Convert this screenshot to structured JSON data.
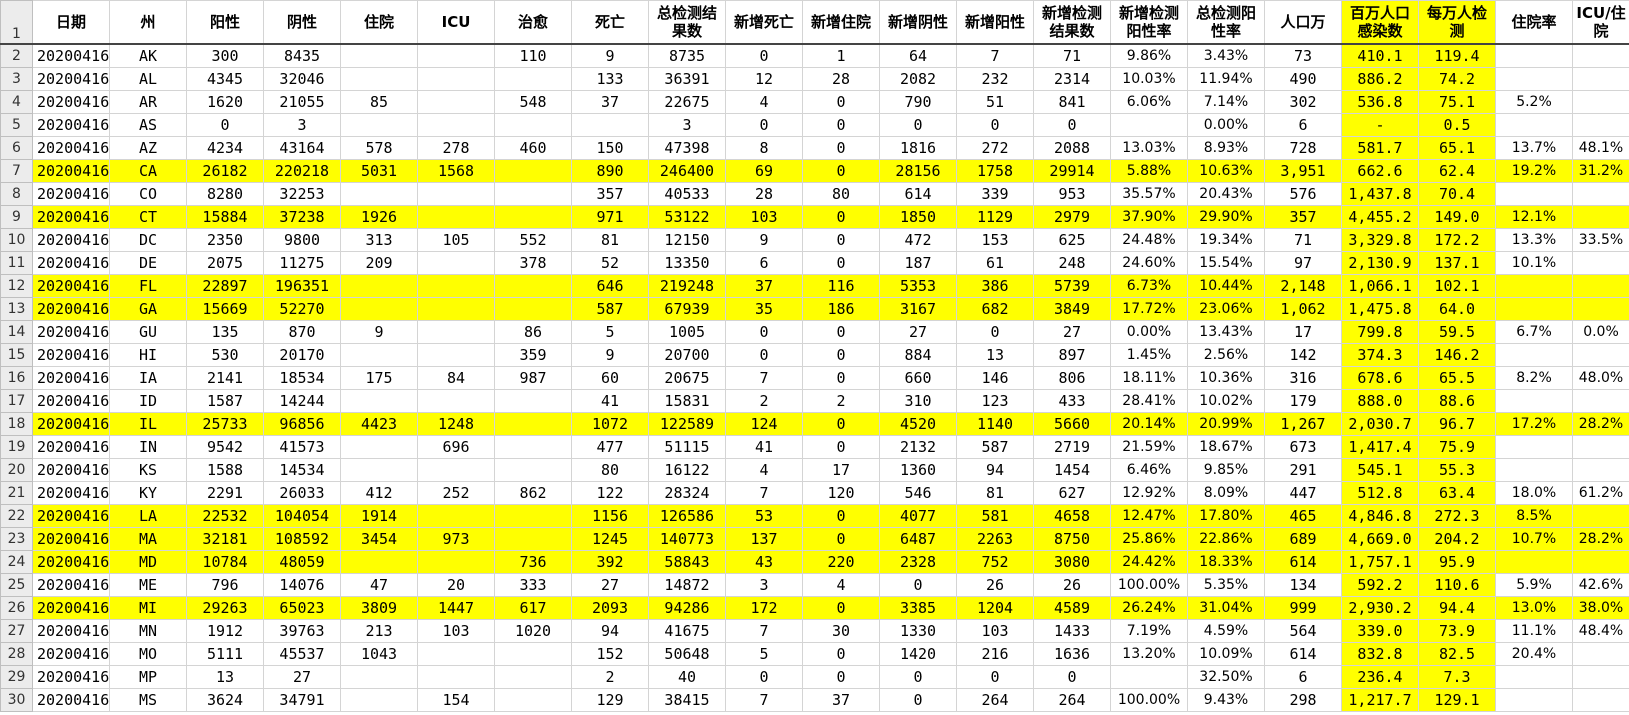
{
  "sheet": {
    "headers": [
      {
        "key": "date",
        "label": "日期"
      },
      {
        "key": "state",
        "label": "州"
      },
      {
        "key": "positive",
        "label": "阳性"
      },
      {
        "key": "negative",
        "label": "阴性"
      },
      {
        "key": "hospitalized",
        "label": "住院"
      },
      {
        "key": "icu",
        "label": "ICU"
      },
      {
        "key": "recovered",
        "label": "治愈"
      },
      {
        "key": "deaths",
        "label": "死亡"
      },
      {
        "key": "total_tests",
        "label": "总检测结果数"
      },
      {
        "key": "new_deaths",
        "label": "新增死亡"
      },
      {
        "key": "new_hosp",
        "label": "新增住院"
      },
      {
        "key": "new_neg",
        "label": "新增阴性"
      },
      {
        "key": "new_pos",
        "label": "新增阳性"
      },
      {
        "key": "new_tests",
        "label": "新增检测结果数"
      },
      {
        "key": "new_pos_rate",
        "label": "新增检测阳性率"
      },
      {
        "key": "total_pos_rate",
        "label": "总检测阳性率"
      },
      {
        "key": "population",
        "label": "人口万"
      },
      {
        "key": "per_million",
        "label": "百万人口感染数"
      },
      {
        "key": "per_10k_tests",
        "label": "每万人检测"
      },
      {
        "key": "hosp_rate",
        "label": "住院率"
      },
      {
        "key": "icu_hosp",
        "label": "ICU/住院"
      }
    ],
    "row_numbers": [
      "1",
      "2",
      "3",
      "4",
      "5",
      "6",
      "7",
      "8",
      "9",
      "10",
      "11",
      "12",
      "13",
      "14",
      "15",
      "16",
      "17",
      "18",
      "19",
      "20",
      "21",
      "22",
      "23",
      "24",
      "25",
      "26",
      "27",
      "28",
      "29",
      "30"
    ],
    "rows": [
      {
        "highlight": false,
        "cells": [
          "20200416",
          "AK",
          "300",
          "8435",
          "",
          "",
          "110",
          "9",
          "8735",
          "0",
          "1",
          "64",
          "7",
          "71",
          "9.86%",
          "3.43%",
          "73",
          "410.1",
          "119.4",
          "",
          ""
        ]
      },
      {
        "highlight": false,
        "cells": [
          "20200416",
          "AL",
          "4345",
          "32046",
          "",
          "",
          "",
          "133",
          "36391",
          "12",
          "28",
          "2082",
          "232",
          "2314",
          "10.03%",
          "11.94%",
          "490",
          "886.2",
          "74.2",
          "",
          ""
        ]
      },
      {
        "highlight": false,
        "cells": [
          "20200416",
          "AR",
          "1620",
          "21055",
          "85",
          "",
          "548",
          "37",
          "22675",
          "4",
          "0",
          "790",
          "51",
          "841",
          "6.06%",
          "7.14%",
          "302",
          "536.8",
          "75.1",
          "5.2%",
          ""
        ]
      },
      {
        "highlight": false,
        "cells": [
          "20200416",
          "AS",
          "0",
          "3",
          "",
          "",
          "",
          "",
          "3",
          "0",
          "0",
          "0",
          "0",
          "0",
          "",
          "0.00%",
          "6",
          "-",
          "0.5",
          "",
          ""
        ]
      },
      {
        "highlight": false,
        "cells": [
          "20200416",
          "AZ",
          "4234",
          "43164",
          "578",
          "278",
          "460",
          "150",
          "47398",
          "8",
          "0",
          "1816",
          "272",
          "2088",
          "13.03%",
          "8.93%",
          "728",
          "581.7",
          "65.1",
          "13.7%",
          "48.1%"
        ]
      },
      {
        "highlight": true,
        "cells": [
          "20200416",
          "CA",
          "26182",
          "220218",
          "5031",
          "1568",
          "",
          "890",
          "246400",
          "69",
          "0",
          "28156",
          "1758",
          "29914",
          "5.88%",
          "10.63%",
          "3,951",
          "662.6",
          "62.4",
          "19.2%",
          "31.2%"
        ]
      },
      {
        "highlight": false,
        "cells": [
          "20200416",
          "CO",
          "8280",
          "32253",
          "",
          "",
          "",
          "357",
          "40533",
          "28",
          "80",
          "614",
          "339",
          "953",
          "35.57%",
          "20.43%",
          "576",
          "1,437.8",
          "70.4",
          "",
          ""
        ]
      },
      {
        "highlight": true,
        "cells": [
          "20200416",
          "CT",
          "15884",
          "37238",
          "1926",
          "",
          "",
          "971",
          "53122",
          "103",
          "0",
          "1850",
          "1129",
          "2979",
          "37.90%",
          "29.90%",
          "357",
          "4,455.2",
          "149.0",
          "12.1%",
          ""
        ]
      },
      {
        "highlight": false,
        "cells": [
          "20200416",
          "DC",
          "2350",
          "9800",
          "313",
          "105",
          "552",
          "81",
          "12150",
          "9",
          "0",
          "472",
          "153",
          "625",
          "24.48%",
          "19.34%",
          "71",
          "3,329.8",
          "172.2",
          "13.3%",
          "33.5%"
        ]
      },
      {
        "highlight": false,
        "cells": [
          "20200416",
          "DE",
          "2075",
          "11275",
          "209",
          "",
          "378",
          "52",
          "13350",
          "6",
          "0",
          "187",
          "61",
          "248",
          "24.60%",
          "15.54%",
          "97",
          "2,130.9",
          "137.1",
          "10.1%",
          ""
        ]
      },
      {
        "highlight": true,
        "cells": [
          "20200416",
          "FL",
          "22897",
          "196351",
          "",
          "",
          "",
          "646",
          "219248",
          "37",
          "116",
          "5353",
          "386",
          "5739",
          "6.73%",
          "10.44%",
          "2,148",
          "1,066.1",
          "102.1",
          "",
          ""
        ]
      },
      {
        "highlight": true,
        "cells": [
          "20200416",
          "GA",
          "15669",
          "52270",
          "",
          "",
          "",
          "587",
          "67939",
          "35",
          "186",
          "3167",
          "682",
          "3849",
          "17.72%",
          "23.06%",
          "1,062",
          "1,475.8",
          "64.0",
          "",
          ""
        ]
      },
      {
        "highlight": false,
        "cells": [
          "20200416",
          "GU",
          "135",
          "870",
          "9",
          "",
          "86",
          "5",
          "1005",
          "0",
          "0",
          "27",
          "0",
          "27",
          "0.00%",
          "13.43%",
          "17",
          "799.8",
          "59.5",
          "6.7%",
          "0.0%"
        ]
      },
      {
        "highlight": false,
        "cells": [
          "20200416",
          "HI",
          "530",
          "20170",
          "",
          "",
          "359",
          "9",
          "20700",
          "0",
          "0",
          "884",
          "13",
          "897",
          "1.45%",
          "2.56%",
          "142",
          "374.3",
          "146.2",
          "",
          ""
        ]
      },
      {
        "highlight": false,
        "cells": [
          "20200416",
          "IA",
          "2141",
          "18534",
          "175",
          "84",
          "987",
          "60",
          "20675",
          "7",
          "0",
          "660",
          "146",
          "806",
          "18.11%",
          "10.36%",
          "316",
          "678.6",
          "65.5",
          "8.2%",
          "48.0%"
        ]
      },
      {
        "highlight": false,
        "cells": [
          "20200416",
          "ID",
          "1587",
          "14244",
          "",
          "",
          "",
          "41",
          "15831",
          "2",
          "2",
          "310",
          "123",
          "433",
          "28.41%",
          "10.02%",
          "179",
          "888.0",
          "88.6",
          "",
          ""
        ]
      },
      {
        "highlight": true,
        "cells": [
          "20200416",
          "IL",
          "25733",
          "96856",
          "4423",
          "1248",
          "",
          "1072",
          "122589",
          "124",
          "0",
          "4520",
          "1140",
          "5660",
          "20.14%",
          "20.99%",
          "1,267",
          "2,030.7",
          "96.7",
          "17.2%",
          "28.2%"
        ]
      },
      {
        "highlight": false,
        "cells": [
          "20200416",
          "IN",
          "9542",
          "41573",
          "",
          "696",
          "",
          "477",
          "51115",
          "41",
          "0",
          "2132",
          "587",
          "2719",
          "21.59%",
          "18.67%",
          "673",
          "1,417.4",
          "75.9",
          "",
          ""
        ]
      },
      {
        "highlight": false,
        "cells": [
          "20200416",
          "KS",
          "1588",
          "14534",
          "",
          "",
          "",
          "80",
          "16122",
          "4",
          "17",
          "1360",
          "94",
          "1454",
          "6.46%",
          "9.85%",
          "291",
          "545.1",
          "55.3",
          "",
          ""
        ]
      },
      {
        "highlight": false,
        "cells": [
          "20200416",
          "KY",
          "2291",
          "26033",
          "412",
          "252",
          "862",
          "122",
          "28324",
          "7",
          "120",
          "546",
          "81",
          "627",
          "12.92%",
          "8.09%",
          "447",
          "512.8",
          "63.4",
          "18.0%",
          "61.2%"
        ]
      },
      {
        "highlight": true,
        "cells": [
          "20200416",
          "LA",
          "22532",
          "104054",
          "1914",
          "",
          "",
          "1156",
          "126586",
          "53",
          "0",
          "4077",
          "581",
          "4658",
          "12.47%",
          "17.80%",
          "465",
          "4,846.8",
          "272.3",
          "8.5%",
          ""
        ]
      },
      {
        "highlight": true,
        "cells": [
          "20200416",
          "MA",
          "32181",
          "108592",
          "3454",
          "973",
          "",
          "1245",
          "140773",
          "137",
          "0",
          "6487",
          "2263",
          "8750",
          "25.86%",
          "22.86%",
          "689",
          "4,669.0",
          "204.2",
          "10.7%",
          "28.2%"
        ]
      },
      {
        "highlight": true,
        "cells": [
          "20200416",
          "MD",
          "10784",
          "48059",
          "",
          "",
          "736",
          "392",
          "58843",
          "43",
          "220",
          "2328",
          "752",
          "3080",
          "24.42%",
          "18.33%",
          "614",
          "1,757.1",
          "95.9",
          "",
          ""
        ]
      },
      {
        "highlight": false,
        "cells": [
          "20200416",
          "ME",
          "796",
          "14076",
          "47",
          "20",
          "333",
          "27",
          "14872",
          "3",
          "4",
          "0",
          "26",
          "26",
          "100.00%",
          "5.35%",
          "134",
          "592.2",
          "110.6",
          "5.9%",
          "42.6%"
        ]
      },
      {
        "highlight": true,
        "cells": [
          "20200416",
          "MI",
          "29263",
          "65023",
          "3809",
          "1447",
          "617",
          "2093",
          "94286",
          "172",
          "0",
          "3385",
          "1204",
          "4589",
          "26.24%",
          "31.04%",
          "999",
          "2,930.2",
          "94.4",
          "13.0%",
          "38.0%"
        ]
      },
      {
        "highlight": false,
        "cells": [
          "20200416",
          "MN",
          "1912",
          "39763",
          "213",
          "103",
          "1020",
          "94",
          "41675",
          "7",
          "30",
          "1330",
          "103",
          "1433",
          "7.19%",
          "4.59%",
          "564",
          "339.0",
          "73.9",
          "11.1%",
          "48.4%"
        ]
      },
      {
        "highlight": false,
        "cells": [
          "20200416",
          "MO",
          "5111",
          "45537",
          "1043",
          "",
          "",
          "152",
          "50648",
          "5",
          "0",
          "1420",
          "216",
          "1636",
          "13.20%",
          "10.09%",
          "614",
          "832.8",
          "82.5",
          "20.4%",
          ""
        ]
      },
      {
        "highlight": false,
        "cells": [
          "20200416",
          "MP",
          "13",
          "27",
          "",
          "",
          "",
          "2",
          "40",
          "0",
          "0",
          "0",
          "0",
          "0",
          "",
          "32.50%",
          "6",
          "236.4",
          "7.3",
          "",
          ""
        ]
      },
      {
        "highlight": false,
        "cells": [
          "20200416",
          "MS",
          "3624",
          "34791",
          "",
          "154",
          "",
          "129",
          "38415",
          "7",
          "37",
          "0",
          "264",
          "264",
          "100.00%",
          "9.43%",
          "298",
          "1,217.7",
          "129.1",
          "",
          ""
        ]
      }
    ],
    "highlight_color": "#ffff00"
  }
}
